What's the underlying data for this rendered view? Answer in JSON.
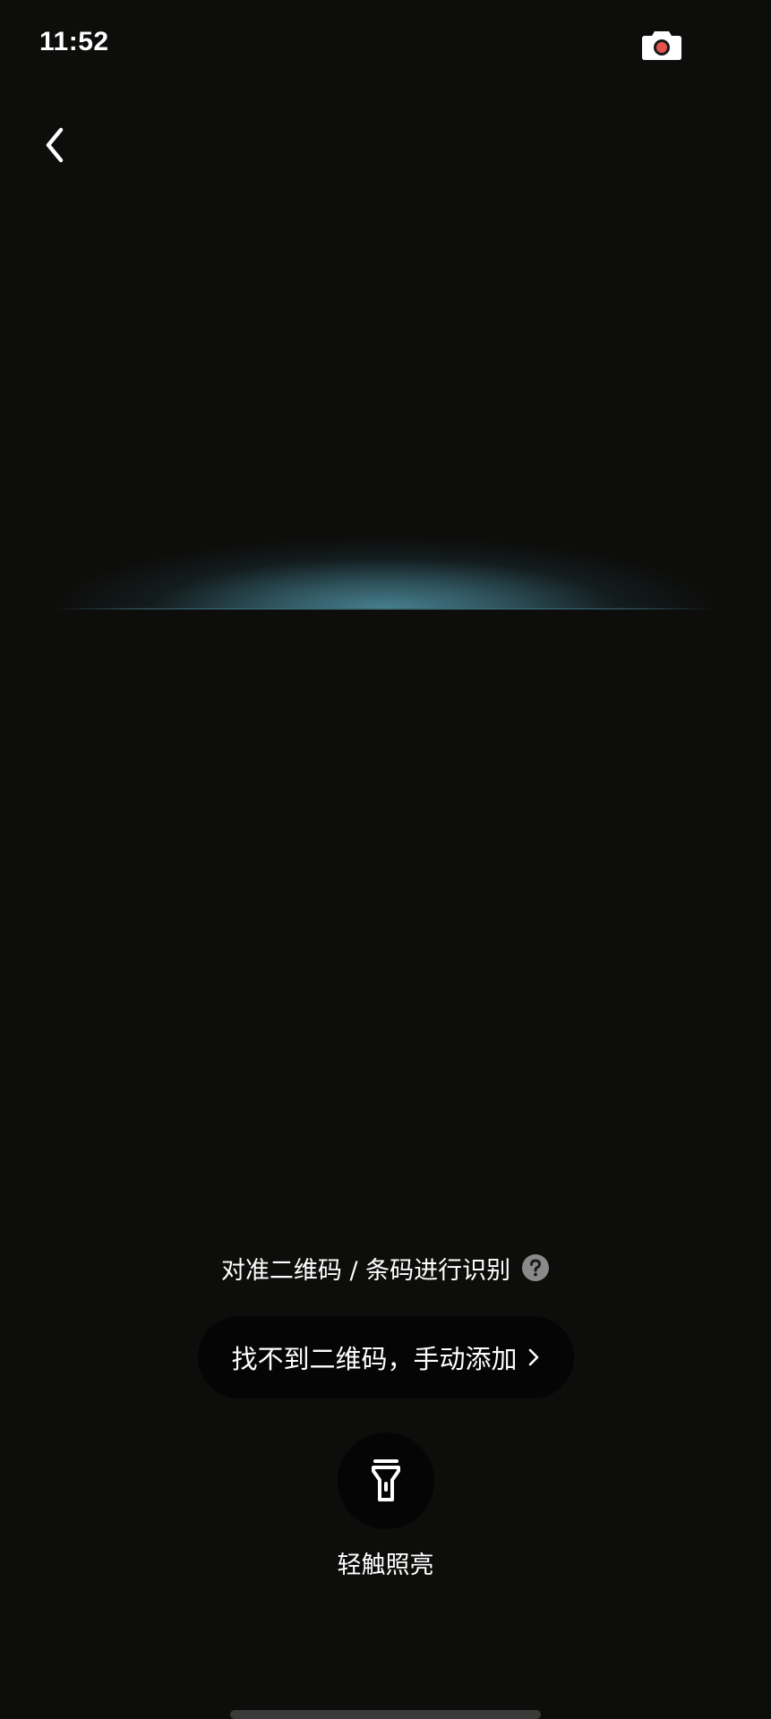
{
  "status_bar": {
    "time": "11:52",
    "icons": [
      "screen-record-icon"
    ]
  },
  "navigation": {
    "back_icon": "chevron-left-icon"
  },
  "scanner": {
    "hint": "对准二维码 / 条码进行识别",
    "help_icon": "question-circle-icon",
    "scan_line_color": "#4a8696"
  },
  "manual_add": {
    "label": "找不到二维码，手动添加",
    "chevron_icon": "chevron-right-icon"
  },
  "flashlight": {
    "icon": "flashlight-icon",
    "label": "轻触照亮"
  },
  "colors": {
    "background": "#0d0d0b",
    "button_background": "#050505",
    "text": "#ffffff",
    "help_icon": "#8a8a8a",
    "record_dot": "#e5534b"
  }
}
